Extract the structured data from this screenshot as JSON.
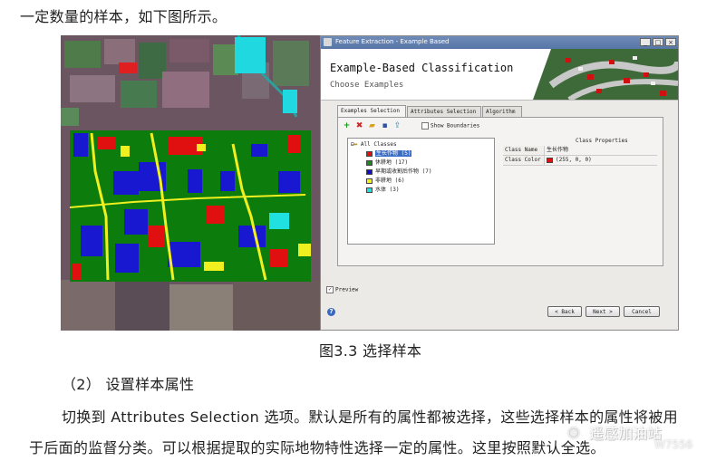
{
  "intro": "一定数量的样本，如下图所示。",
  "caption": "图3.3   选择样本",
  "step": "（2）  设置样本属性",
  "para1": "切换到 Attributes Selection 选项。默认是所有的属性都被选择，这些选择样本的属性将被用",
  "para2": "于后面的监督分类。可以根据提取的实际地物特性选择一定的属性。这里按照默认全选。",
  "dialog": {
    "window_title": "Feature Extraction - Example Based",
    "header_title": "Example-Based Classification",
    "header_sub": "Choose Examples",
    "tabs": [
      "Examples Selection",
      "Attributes Selection",
      "Algorithm"
    ],
    "show_boundaries": "Show Boundaries",
    "tree_root": "All Classes",
    "classes": [
      {
        "name": "生长作物  (5)",
        "color": "#e01010"
      },
      {
        "name": "休耕地  (17)",
        "color": "#1a8a1a"
      },
      {
        "name": "早期或收割后作物  (7)",
        "color": "#1010c8"
      },
      {
        "name": "非耕地  (6)",
        "color": "#f0f020"
      },
      {
        "name": "水体  (3)",
        "color": "#20e0e0"
      }
    ],
    "props_header": "Class Properties",
    "props": [
      {
        "key": "Class Name",
        "value": "生长作物"
      },
      {
        "key": "Class Color",
        "value": "(255, 0, 0)"
      }
    ],
    "preview": "Preview",
    "buttons": {
      "back": "< Back",
      "next": "Next >",
      "cancel": "Cancel"
    }
  },
  "watermark": {
    "title": "遥感加油站",
    "id": "W7556"
  }
}
